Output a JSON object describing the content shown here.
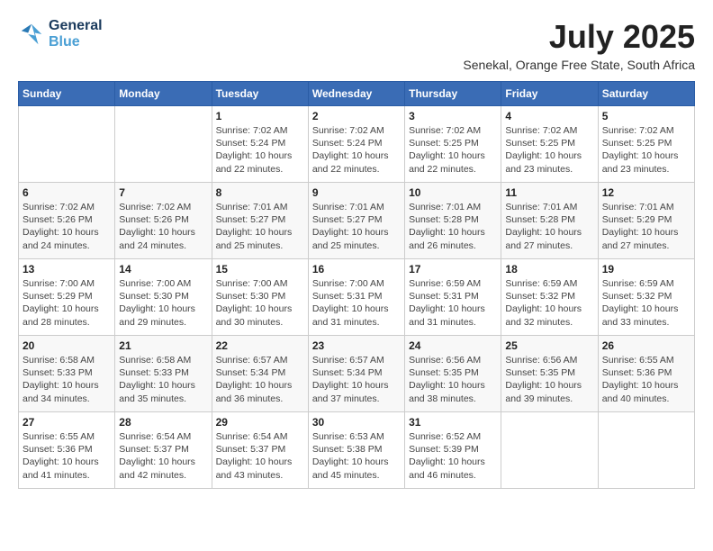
{
  "header": {
    "logo_line1": "General",
    "logo_line2": "Blue",
    "month_year": "July 2025",
    "location": "Senekal, Orange Free State, South Africa"
  },
  "weekdays": [
    "Sunday",
    "Monday",
    "Tuesday",
    "Wednesday",
    "Thursday",
    "Friday",
    "Saturday"
  ],
  "weeks": [
    [
      {
        "day": "",
        "info": ""
      },
      {
        "day": "",
        "info": ""
      },
      {
        "day": "1",
        "info": "Sunrise: 7:02 AM\nSunset: 5:24 PM\nDaylight: 10 hours\nand 22 minutes."
      },
      {
        "day": "2",
        "info": "Sunrise: 7:02 AM\nSunset: 5:24 PM\nDaylight: 10 hours\nand 22 minutes."
      },
      {
        "day": "3",
        "info": "Sunrise: 7:02 AM\nSunset: 5:25 PM\nDaylight: 10 hours\nand 22 minutes."
      },
      {
        "day": "4",
        "info": "Sunrise: 7:02 AM\nSunset: 5:25 PM\nDaylight: 10 hours\nand 23 minutes."
      },
      {
        "day": "5",
        "info": "Sunrise: 7:02 AM\nSunset: 5:25 PM\nDaylight: 10 hours\nand 23 minutes."
      }
    ],
    [
      {
        "day": "6",
        "info": "Sunrise: 7:02 AM\nSunset: 5:26 PM\nDaylight: 10 hours\nand 24 minutes."
      },
      {
        "day": "7",
        "info": "Sunrise: 7:02 AM\nSunset: 5:26 PM\nDaylight: 10 hours\nand 24 minutes."
      },
      {
        "day": "8",
        "info": "Sunrise: 7:01 AM\nSunset: 5:27 PM\nDaylight: 10 hours\nand 25 minutes."
      },
      {
        "day": "9",
        "info": "Sunrise: 7:01 AM\nSunset: 5:27 PM\nDaylight: 10 hours\nand 25 minutes."
      },
      {
        "day": "10",
        "info": "Sunrise: 7:01 AM\nSunset: 5:28 PM\nDaylight: 10 hours\nand 26 minutes."
      },
      {
        "day": "11",
        "info": "Sunrise: 7:01 AM\nSunset: 5:28 PM\nDaylight: 10 hours\nand 27 minutes."
      },
      {
        "day": "12",
        "info": "Sunrise: 7:01 AM\nSunset: 5:29 PM\nDaylight: 10 hours\nand 27 minutes."
      }
    ],
    [
      {
        "day": "13",
        "info": "Sunrise: 7:00 AM\nSunset: 5:29 PM\nDaylight: 10 hours\nand 28 minutes."
      },
      {
        "day": "14",
        "info": "Sunrise: 7:00 AM\nSunset: 5:30 PM\nDaylight: 10 hours\nand 29 minutes."
      },
      {
        "day": "15",
        "info": "Sunrise: 7:00 AM\nSunset: 5:30 PM\nDaylight: 10 hours\nand 30 minutes."
      },
      {
        "day": "16",
        "info": "Sunrise: 7:00 AM\nSunset: 5:31 PM\nDaylight: 10 hours\nand 31 minutes."
      },
      {
        "day": "17",
        "info": "Sunrise: 6:59 AM\nSunset: 5:31 PM\nDaylight: 10 hours\nand 31 minutes."
      },
      {
        "day": "18",
        "info": "Sunrise: 6:59 AM\nSunset: 5:32 PM\nDaylight: 10 hours\nand 32 minutes."
      },
      {
        "day": "19",
        "info": "Sunrise: 6:59 AM\nSunset: 5:32 PM\nDaylight: 10 hours\nand 33 minutes."
      }
    ],
    [
      {
        "day": "20",
        "info": "Sunrise: 6:58 AM\nSunset: 5:33 PM\nDaylight: 10 hours\nand 34 minutes."
      },
      {
        "day": "21",
        "info": "Sunrise: 6:58 AM\nSunset: 5:33 PM\nDaylight: 10 hours\nand 35 minutes."
      },
      {
        "day": "22",
        "info": "Sunrise: 6:57 AM\nSunset: 5:34 PM\nDaylight: 10 hours\nand 36 minutes."
      },
      {
        "day": "23",
        "info": "Sunrise: 6:57 AM\nSunset: 5:34 PM\nDaylight: 10 hours\nand 37 minutes."
      },
      {
        "day": "24",
        "info": "Sunrise: 6:56 AM\nSunset: 5:35 PM\nDaylight: 10 hours\nand 38 minutes."
      },
      {
        "day": "25",
        "info": "Sunrise: 6:56 AM\nSunset: 5:35 PM\nDaylight: 10 hours\nand 39 minutes."
      },
      {
        "day": "26",
        "info": "Sunrise: 6:55 AM\nSunset: 5:36 PM\nDaylight: 10 hours\nand 40 minutes."
      }
    ],
    [
      {
        "day": "27",
        "info": "Sunrise: 6:55 AM\nSunset: 5:36 PM\nDaylight: 10 hours\nand 41 minutes."
      },
      {
        "day": "28",
        "info": "Sunrise: 6:54 AM\nSunset: 5:37 PM\nDaylight: 10 hours\nand 42 minutes."
      },
      {
        "day": "29",
        "info": "Sunrise: 6:54 AM\nSunset: 5:37 PM\nDaylight: 10 hours\nand 43 minutes."
      },
      {
        "day": "30",
        "info": "Sunrise: 6:53 AM\nSunset: 5:38 PM\nDaylight: 10 hours\nand 45 minutes."
      },
      {
        "day": "31",
        "info": "Sunrise: 6:52 AM\nSunset: 5:39 PM\nDaylight: 10 hours\nand 46 minutes."
      },
      {
        "day": "",
        "info": ""
      },
      {
        "day": "",
        "info": ""
      }
    ]
  ]
}
